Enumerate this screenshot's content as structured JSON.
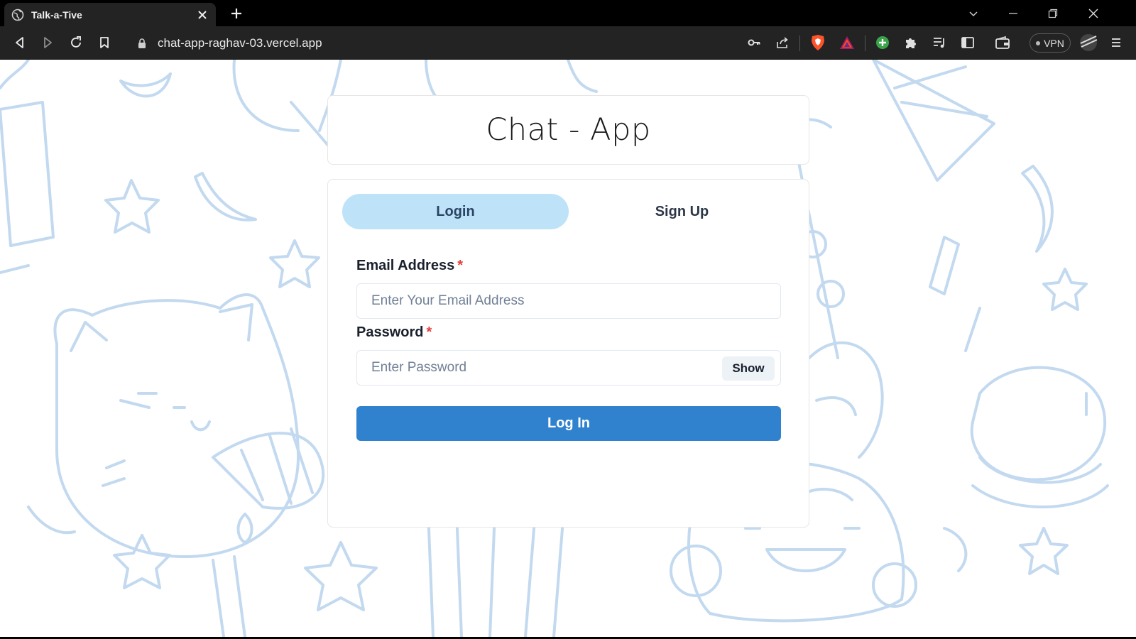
{
  "browser": {
    "tab_title": "Talk-a-Tive",
    "url": "chat-app-raghav-03.vercel.app",
    "vpn_label": "VPN"
  },
  "page": {
    "app_title": "Chat - App",
    "tabs": [
      {
        "label": "Login",
        "active": true
      },
      {
        "label": "Sign Up",
        "active": false
      }
    ],
    "email": {
      "label": "Email Address",
      "required_mark": "*",
      "placeholder": "Enter Your Email Address",
      "value": ""
    },
    "password": {
      "label": "Password",
      "required_mark": "*",
      "placeholder": "Enter Password",
      "value": "",
      "toggle_label": "Show"
    },
    "submit_label": "Log In"
  },
  "colors": {
    "accent": "#3182ce",
    "active_tab": "#bee3f8",
    "required": "#e53e3e",
    "doodle": "#c2d9ef"
  }
}
